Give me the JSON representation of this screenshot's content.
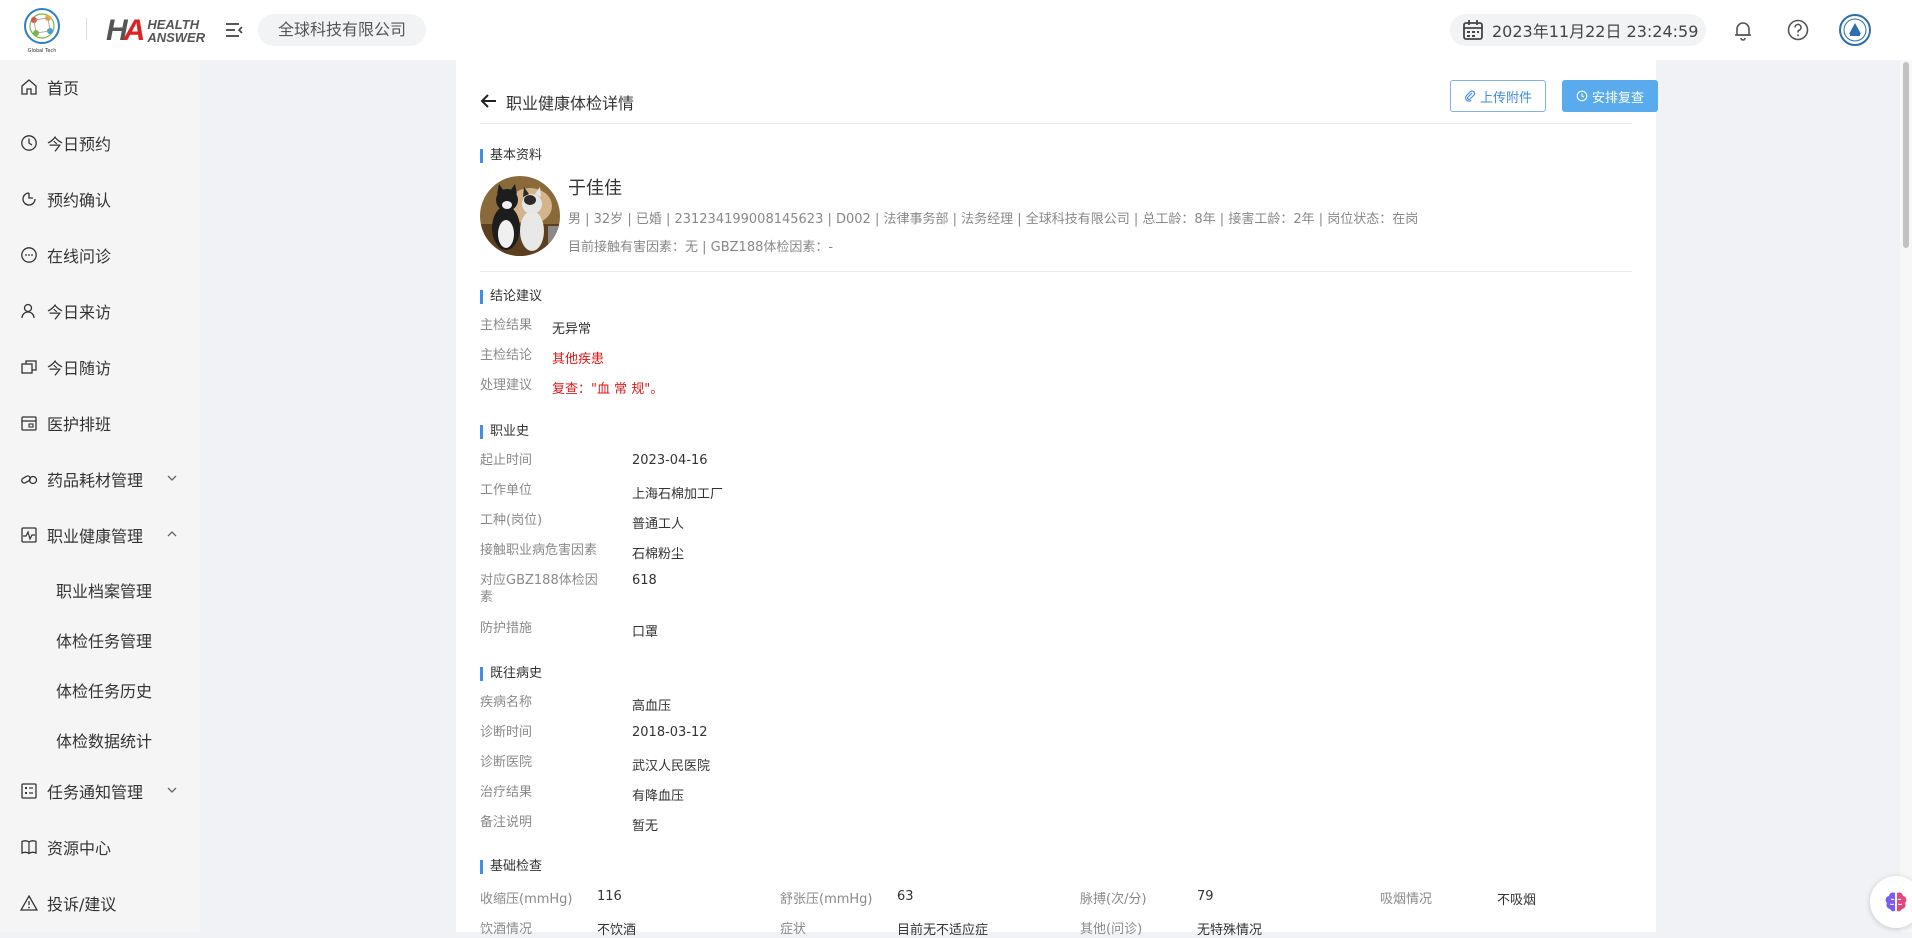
{
  "header": {
    "logo_global_text": "Global Tech",
    "logo_ha_line1": "HEALTH",
    "logo_ha_line2": "ANSWER",
    "company": "全球科技有限公司",
    "datetime": "2023年11月22日 23:24:59"
  },
  "sidebar": {
    "items": [
      {
        "label": "首页",
        "icon": "home-icon"
      },
      {
        "label": "今日预约",
        "icon": "clock-icon"
      },
      {
        "label": "预约确认",
        "icon": "refresh-icon"
      },
      {
        "label": "在线问诊",
        "icon": "chat-icon"
      },
      {
        "label": "今日来访",
        "icon": "user-icon"
      },
      {
        "label": "今日随访",
        "icon": "copy-icon"
      },
      {
        "label": "医护排班",
        "icon": "calendar-icon"
      },
      {
        "label": "药品耗材管理",
        "icon": "medicine-icon"
      },
      {
        "label": "职业健康管理",
        "icon": "pulse-icon"
      },
      {
        "label": "任务通知管理",
        "icon": "list-icon"
      },
      {
        "label": "资源中心",
        "icon": "book-icon"
      },
      {
        "label": "投诉/建议",
        "icon": "warning-icon"
      }
    ],
    "sub_items": [
      "职业档案管理",
      "体检任务管理",
      "体检任务历史",
      "体检数据统计"
    ]
  },
  "page": {
    "title": "职业健康体检详情",
    "upload_label": "上传附件",
    "recheck_label": "安排复查"
  },
  "basic": {
    "section": "基本资料",
    "name": "于佳佳",
    "info": "男 | 32岁 | 已婚 | 231234199008145623 | D002 | 法律事务部 | 法务经理 | 全球科技有限公司 | 总工龄：8年 | 接害工龄：2年 | 岗位状态：在岗",
    "hazard": "目前接触有害因素：无 | GBZ188体检因素：-"
  },
  "conclusion": {
    "section": "结论建议",
    "rows": [
      {
        "label": "主检结果",
        "value": "无异常"
      },
      {
        "label": "主检结论",
        "value": "其他疾患"
      },
      {
        "label": "处理建议",
        "value": "复查：\"血 常 规\"。"
      }
    ]
  },
  "occupation": {
    "section": "职业史",
    "rows": [
      {
        "label": "起止时间",
        "value": "2023-04-16"
      },
      {
        "label": "工作单位",
        "value": "上海石棉加工厂"
      },
      {
        "label": "工种(岗位)",
        "value": "普通工人"
      },
      {
        "label": "接触职业病危害因素",
        "value": "石棉粉尘"
      },
      {
        "label": "对应GBZ188体检因素",
        "value": "618"
      },
      {
        "label": "防护措施",
        "value": "口罩"
      }
    ]
  },
  "history": {
    "section": "既往病史",
    "rows": [
      {
        "label": "疾病名称",
        "value": "高血压"
      },
      {
        "label": "诊断时间",
        "value": "2018-03-12"
      },
      {
        "label": "诊断医院",
        "value": "武汉人民医院"
      },
      {
        "label": "治疗结果",
        "value": "有降血压"
      },
      {
        "label": "备注说明",
        "value": "暂无"
      }
    ]
  },
  "basic_exam": {
    "section": "基础检查",
    "rows": [
      [
        {
          "label": "收缩压(mmHg)",
          "value": "116"
        },
        {
          "label": "舒张压(mmHg)",
          "value": "63"
        },
        {
          "label": "脉搏(次/分)",
          "value": "79"
        },
        {
          "label": "吸烟情况",
          "value": "不吸烟"
        }
      ],
      [
        {
          "label": "饮酒情况",
          "value": "不饮酒"
        },
        {
          "label": "症状",
          "value": "目前无不适应症"
        },
        {
          "label": "其他(问诊)",
          "value": "无特殊情况"
        }
      ]
    ]
  }
}
